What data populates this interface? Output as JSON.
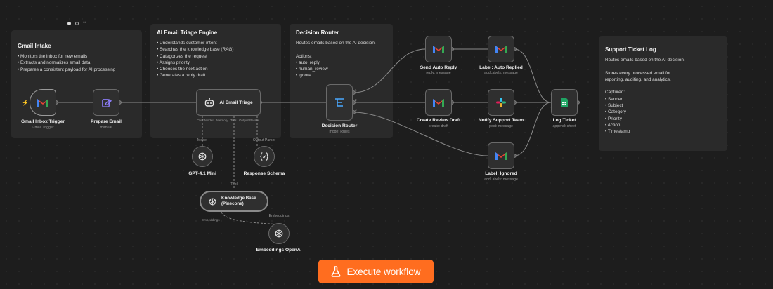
{
  "pager": {
    "more": "••"
  },
  "notes": {
    "intake": {
      "title": "Gmail Intake",
      "lines": "• Monitors the inbox for new emails\n• Extracts and normalizes email data\n• Prepares a consistent payload for AI processing"
    },
    "triage": {
      "title": "AI Email Triage Engine",
      "lines": "• Understands customer intent\n• Searches the knowledge base (RAG)\n• Categorizes the request\n• Assigns priority\n• Chooses the next action\n• Generates a reply draft"
    },
    "router": {
      "title": "Decision Router",
      "lines": "Routes emails based on the AI decision.\n\nActions:\n• auto_reply\n• human_review\n• ignore"
    },
    "log": {
      "title": "Support Ticket Log",
      "lines": "Routes emails based on the AI decision.\n\nStores every processed email for\nreporting, auditing, and analytics.\n\nCaptured:\n• Sender\n• Subject\n• Category\n• Priority\n• Action\n• Timestamp"
    }
  },
  "nodes": {
    "gmail_trigger": {
      "label": "Gmail Inbox Trigger",
      "sub": "Gmail Trigger",
      "icon": "gmail-icon"
    },
    "prepare": {
      "label": "Prepare Email",
      "sub": "manual",
      "icon": "edit-icon"
    },
    "triage": {
      "label": "AI Email Triage",
      "icon": "robot-icon",
      "ports": {
        "chat": "Chat Model",
        "memory": "Memory",
        "tool": "Tool",
        "parser": "Output Parser"
      }
    },
    "router": {
      "label": "Decision Router",
      "sub": "mode: Rules",
      "icon": "router-icon"
    },
    "auto_reply": {
      "label": "Send Auto Reply",
      "sub": "reply: message",
      "icon": "gmail-icon"
    },
    "label_replied": {
      "label": "Label: Auto Replied",
      "sub": "addLabels: message",
      "icon": "gmail-icon"
    },
    "review_draft": {
      "label": "Create Review Draft",
      "sub": "create: draft",
      "icon": "gmail-icon"
    },
    "notify": {
      "label": "Notify Support Team",
      "sub": "post: message",
      "icon": "slack-icon"
    },
    "label_ignored": {
      "label": "Label: Ignored",
      "sub": "addLabels: message",
      "icon": "gmail-icon"
    },
    "log_ticket": {
      "label": "Log Ticket",
      "sub": "append: sheet",
      "icon": "sheets-icon"
    },
    "gpt": {
      "label": "GPT-4.1 Mini",
      "icon": "openai-icon",
      "top": "Model"
    },
    "schema": {
      "label": "Response Schema",
      "icon": "braces-icon",
      "top": "Output Parser"
    },
    "kb": {
      "label": "Knowledge Base\n(Pinecone)",
      "icon": "openai-icon",
      "top": "Tool",
      "port": "Embeddings"
    },
    "embeddings": {
      "label": "Embeddings OpenAI",
      "icon": "openai-icon",
      "top": "Embeddings"
    }
  },
  "execute": {
    "label": "Execute workflow",
    "icon": "flask-icon"
  },
  "colors": {
    "accent": "#ff6d1f",
    "gmail_red": "#ea4335",
    "sheets_green": "#1fa463",
    "slack_purple": "#611f69"
  }
}
